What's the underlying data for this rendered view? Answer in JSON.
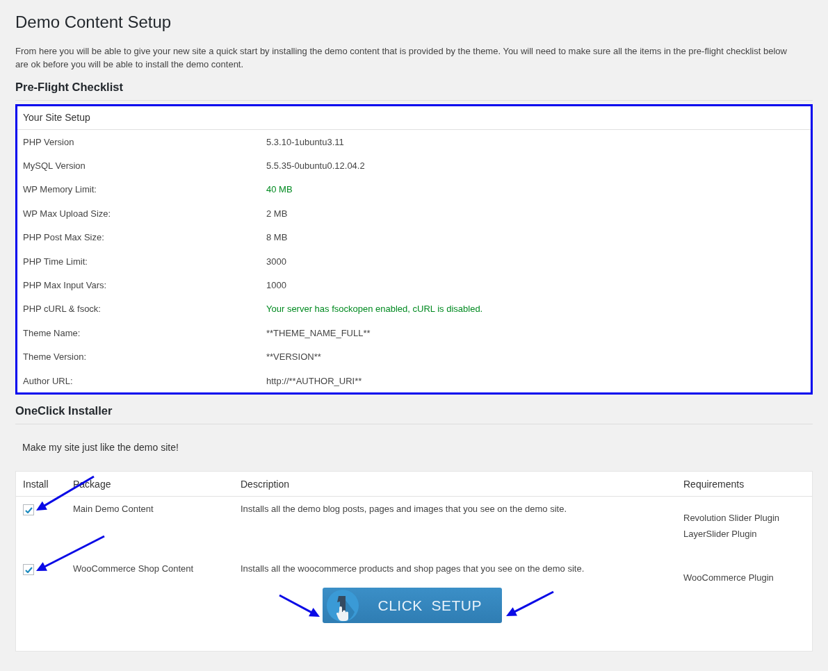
{
  "title": "Demo Content Setup",
  "intro": "From here you will be able to give your new site a quick start by installing the demo content that is provided by the theme. You will need to make sure all the items in the pre-flight checklist below are ok before you will be able to install the demo content.",
  "checklist": {
    "heading": "Pre-Flight Checklist",
    "highlighted": true,
    "table_title": "Your Site Setup",
    "rows": [
      {
        "label": "PHP Version",
        "value": "5.3.10-1ubuntu3.11",
        "ok": false
      },
      {
        "label": "MySQL Version",
        "value": "5.5.35-0ubuntu0.12.04.2",
        "ok": false
      },
      {
        "label": "WP Memory Limit:",
        "value": "40 MB",
        "ok": true
      },
      {
        "label": "WP Max Upload Size:",
        "value": "2 MB",
        "ok": false
      },
      {
        "label": "PHP Post Max Size:",
        "value": "8 MB",
        "ok": false
      },
      {
        "label": "PHP Time Limit:",
        "value": "3000",
        "ok": false
      },
      {
        "label": "PHP Max Input Vars:",
        "value": "1000",
        "ok": false
      },
      {
        "label": "PHP cURL & fsock:",
        "value": "Your server has fsockopen enabled, cURL is disabled.",
        "ok": true
      },
      {
        "label": "Theme Name:",
        "value": "**THEME_NAME_FULL**",
        "ok": false
      },
      {
        "label": "Theme Version:",
        "value": "**VERSION**",
        "ok": false
      },
      {
        "label": "Author URL:",
        "value": "http://**AUTHOR_URI**",
        "ok": false
      }
    ]
  },
  "installer": {
    "heading": "OneClick Installer",
    "tagline": "Make my site just like the demo site!",
    "columns": [
      "Install",
      "Package",
      "Description",
      "Requirements"
    ],
    "rows": [
      {
        "checked": true,
        "package": "Main Demo Content",
        "description": "Installs all the demo blog posts, pages and images that you see on the demo site.",
        "requirements": [
          "Revolution Slider Plugin",
          "LayerSlider Plugin"
        ]
      },
      {
        "checked": true,
        "package": "WooCommerce Shop Content",
        "description": "Installs all the woocommerce products and shop pages that you see on the demo site.",
        "requirements": [
          "WooCommerce Plugin"
        ]
      }
    ],
    "button": "CLICK  SETUP"
  }
}
